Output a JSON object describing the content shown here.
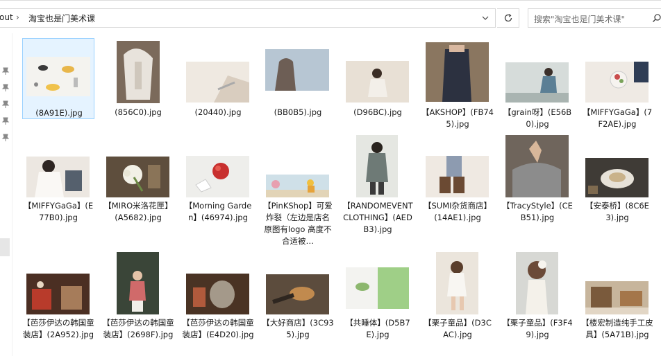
{
  "address_bar": {
    "truncated_segment": "out",
    "current_folder": "淘宝也是门美术课"
  },
  "search": {
    "placeholder": "搜索\"淘宝也是门美术课\""
  },
  "files": [
    {
      "name": "(8A91E).jpg"
    },
    {
      "name": "(856C0).jpg"
    },
    {
      "name": "(20440).jpg"
    },
    {
      "name": "(BB0B5).jpg"
    },
    {
      "name": "(D96BC).jpg"
    },
    {
      "name": "【AKSHOP】(FB745).jpg"
    },
    {
      "name": "【grain呀】(E56B0).jpg"
    },
    {
      "name": "【MIFFYGaGa】(7F2AE).jpg"
    },
    {
      "name": "【MIFFYGaGa】(E77B0).jpg"
    },
    {
      "name": "【MIRO米洛花匣】(A5682).jpg"
    },
    {
      "name": "【Morning Garden】(46974).jpg"
    },
    {
      "name": "【PinKShop】可爱炸裂（左边是店名 原图有logo 高度不合适被…"
    },
    {
      "name": "【RANDOMEVENT CLOTHING】(AEDB3).jpg"
    },
    {
      "name": "【SUMI杂货商店】(14AE1).jpg"
    },
    {
      "name": "【TracyStyle】(CEB51).jpg"
    },
    {
      "name": "【安泰桥】(8C6E3).jpg"
    },
    {
      "name": "【芭莎伊达の韩国童装店】(2A952).jpg"
    },
    {
      "name": "【芭莎伊达の韩国童装店】(2698F).jpg"
    },
    {
      "name": "【芭莎伊达の韩国童装店】(E4D20).jpg"
    },
    {
      "name": "【大好商店】(3C935).jpg"
    },
    {
      "name": "【共睡体】(D5B7E).jpg"
    },
    {
      "name": "【栗子童品】(D3CAC).jpg"
    },
    {
      "name": "【栗子童品】(F3F49).jpg"
    },
    {
      "name": "【楼宏制造纯手工皮具】(5A71B).jpg"
    }
  ]
}
